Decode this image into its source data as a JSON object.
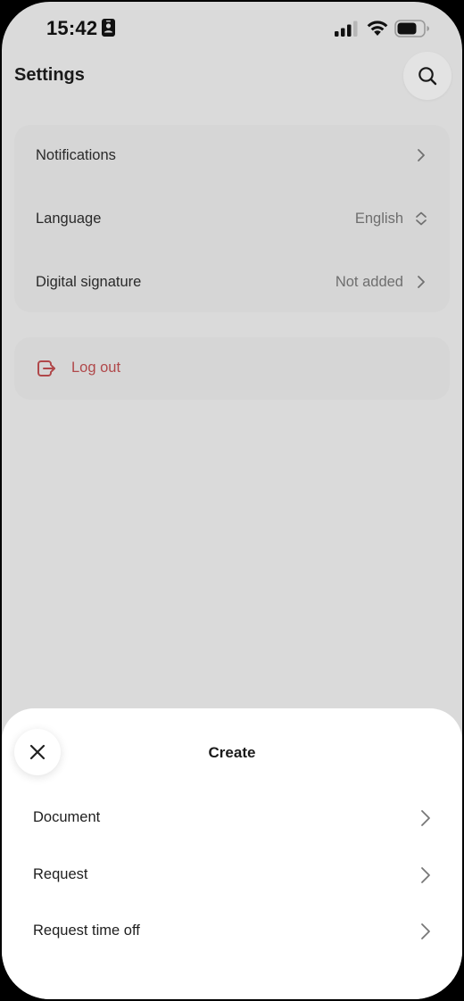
{
  "status_bar": {
    "time": "15:42"
  },
  "header": {
    "title": "Settings"
  },
  "settings": {
    "items": [
      {
        "label": "Notifications",
        "value": "",
        "icon": "chevron-right-icon"
      },
      {
        "label": "Language",
        "value": "English",
        "icon": "expand-collapse-icon"
      },
      {
        "label": "Digital signature",
        "value": "Not added",
        "icon": "chevron-right-icon"
      }
    ]
  },
  "logout": {
    "label": "Log out",
    "icon": "logout-icon",
    "color": "#b0484a"
  },
  "sheet": {
    "title": "Create",
    "items": [
      {
        "label": "Document"
      },
      {
        "label": "Request"
      },
      {
        "label": "Request time off"
      }
    ]
  },
  "colors": {
    "overlay_background": "#dadada",
    "card_background": "#d6d6d6",
    "sheet_background": "#ffffff",
    "danger": "#b0484a"
  }
}
